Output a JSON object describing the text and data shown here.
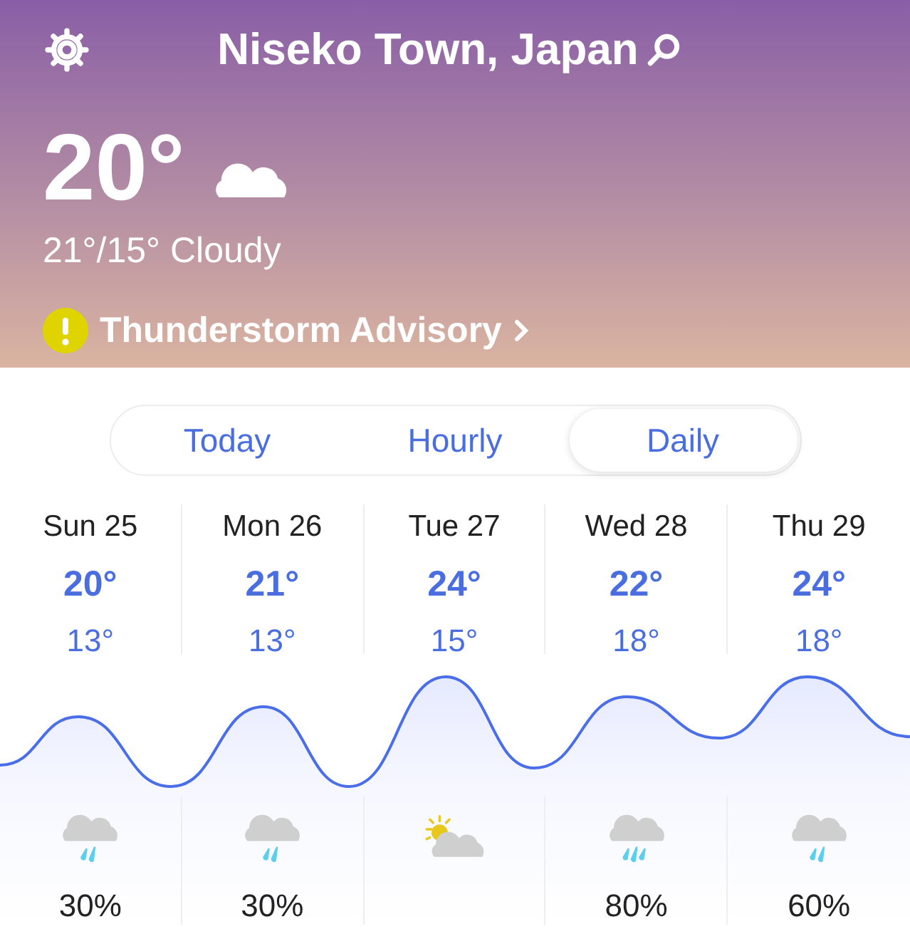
{
  "header": {
    "location": "Niseko Town, Japan",
    "temperature": "20°",
    "summary": "21°/15° Cloudy",
    "alert": "Thunderstorm Advisory"
  },
  "tabs": [
    {
      "label": "Today",
      "selected": false
    },
    {
      "label": "Hourly",
      "selected": false
    },
    {
      "label": "Daily",
      "selected": true
    }
  ],
  "days": [
    {
      "day": "Sun 25",
      "high": "20°",
      "low": "13°",
      "kind": "rain",
      "precipitation": "30%"
    },
    {
      "day": "Mon 26",
      "high": "21°",
      "low": "13°",
      "kind": "rain",
      "precipitation": "30%"
    },
    {
      "day": "Tue 27",
      "high": "24°",
      "low": "15°",
      "kind": "partly-sunny"
    },
    {
      "day": "Wed 28",
      "high": "22°",
      "low": "18°",
      "kind": "heavy-rain",
      "precipitation": "80%"
    },
    {
      "day": "Thu 29",
      "high": "24°",
      "low": "18°",
      "kind": "rain",
      "precipitation": "60%"
    }
  ]
}
